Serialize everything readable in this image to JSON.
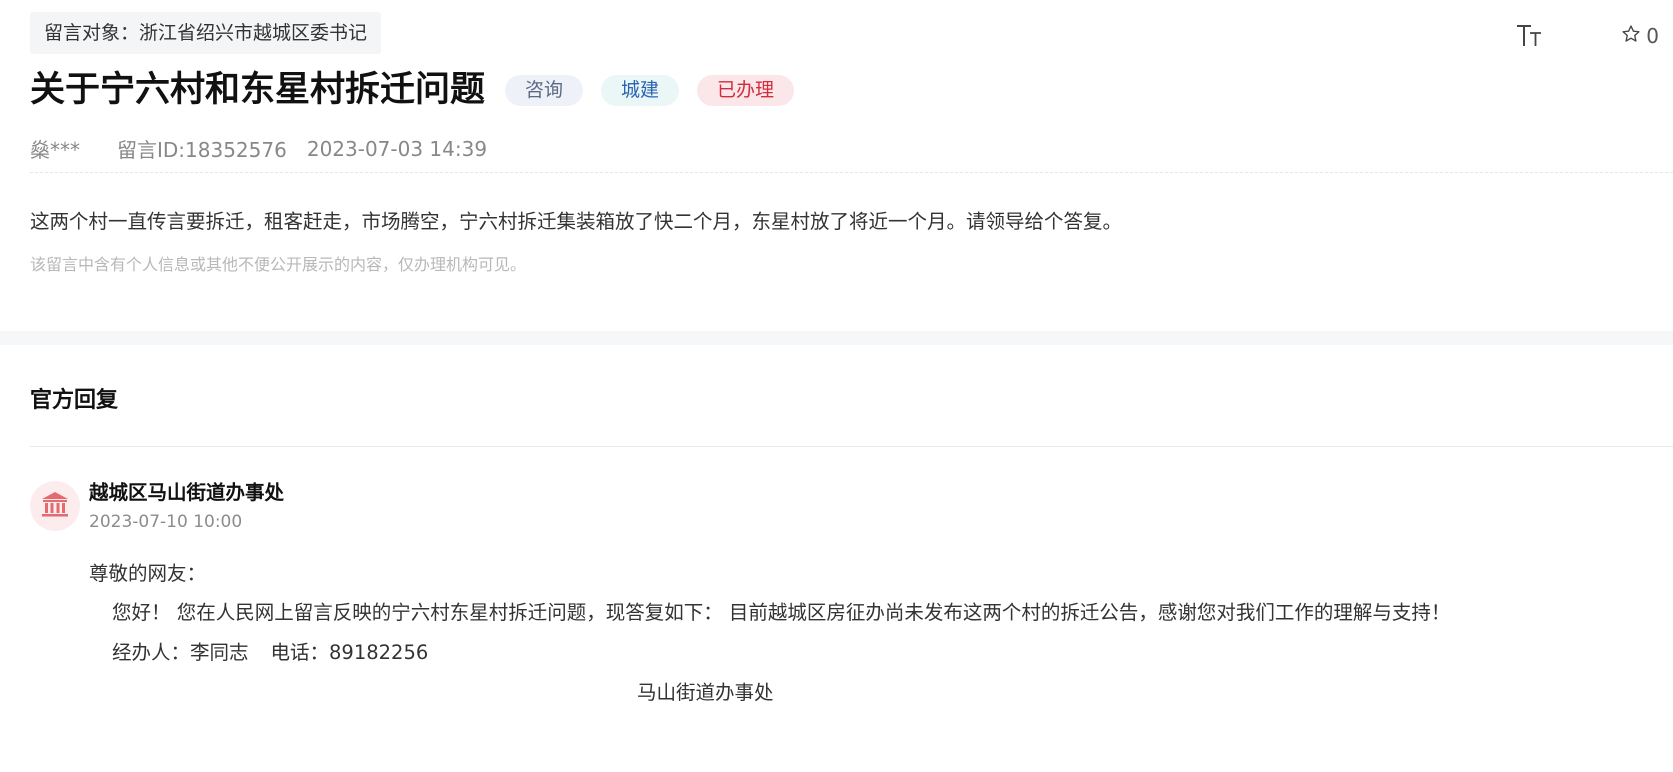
{
  "target": {
    "label": "留言对象：浙江省绍兴市越城区委书记"
  },
  "tools": {
    "font_size_icon": "text-size-icon",
    "favorite_icon": "star-outline-icon",
    "favorite_count": "0"
  },
  "message": {
    "title": "关于宁六村和东星村拆迁问题",
    "tags": [
      {
        "label": "咨询"
      },
      {
        "label": "城建"
      },
      {
        "label": "已办理"
      }
    ],
    "author": "燊***",
    "id_label": "留言ID:18352576",
    "datetime": "2023-07-03 14:39",
    "content": "这两个村一直传言要拆迁，租客赶走，市场腾空，宁六村拆迁集装箱放了快二个月，东星村放了将近一个月。请领导给个答复。",
    "privacy_note": "该留言中含有个人信息或其他不便公开展示的内容，仅办理机构可见。"
  },
  "reply": {
    "heading": "官方回复",
    "avatar_icon": "government-building-icon",
    "org_name": "越城区马山街道办事处",
    "datetime": "2023-07-10 10:00",
    "greeting": "尊敬的网友：",
    "paragraph": "您好！ 您在人民网上留言反映的宁六村东星村拆迁问题，现答复如下： 目前越城区房征办尚未发布这两个村的拆迁公告，感谢您对我们工作的理解与支持！",
    "handler": "经办人：李同志",
    "phone": "电话：89182256",
    "signoff": "马山街道办事处"
  },
  "colors": {
    "tag_consult_bg": "#eef2f8",
    "tag_category_text": "#2c64b3",
    "tag_status_text": "#d22d3c",
    "avatar_bg": "#fdecee",
    "avatar_icon": "#e46a6f"
  }
}
